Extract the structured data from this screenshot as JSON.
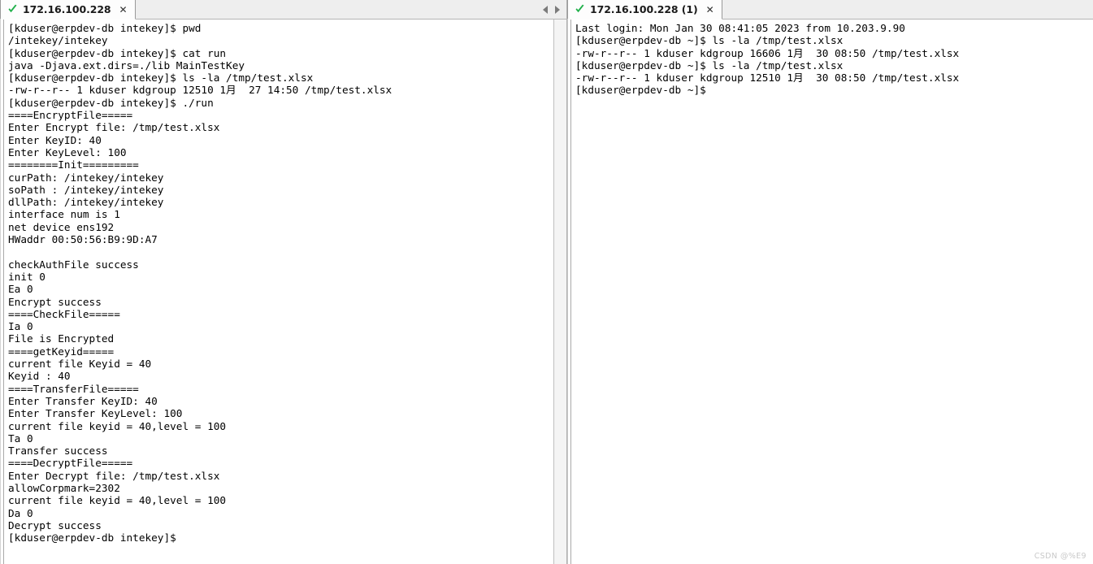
{
  "panels": {
    "left": {
      "tab": {
        "status_icon": "green-check-icon",
        "title": "172.16.100.228",
        "close_label": "✕"
      },
      "nav": {
        "prev_icon": "triangle-left-icon",
        "next_icon": "triangle-right-icon"
      },
      "terminal": {
        "lines": [
          "[kduser@erpdev-db intekey]$ pwd",
          "/intekey/intekey",
          "[kduser@erpdev-db intekey]$ cat run",
          "java -Djava.ext.dirs=./lib MainTestKey",
          "[kduser@erpdev-db intekey]$ ls -la /tmp/test.xlsx",
          "-rw-r--r-- 1 kduser kdgroup 12510 1月  27 14:50 /tmp/test.xlsx",
          "[kduser@erpdev-db intekey]$ ./run",
          "====EncryptFile=====",
          "Enter Encrypt file: /tmp/test.xlsx",
          "Enter KeyID: 40",
          "Enter KeyLevel: 100",
          "========Init=========",
          "curPath: /intekey/intekey",
          "soPath : /intekey/intekey",
          "dllPath: /intekey/intekey",
          "interface num is 1",
          "net device ens192",
          "HWaddr 00:50:56:B9:9D:A7",
          "",
          "checkAuthFile success",
          "init 0",
          "Ea 0",
          "Encrypt success",
          "====CheckFile=====",
          "Ia 0",
          "File is Encrypted",
          "====getKeyid=====",
          "current file Keyid = 40",
          "Keyid : 40",
          "====TransferFile=====",
          "Enter Transfer KeyID: 40",
          "Enter Transfer KeyLevel: 100",
          "current file keyid = 40,level = 100",
          "Ta 0",
          "Transfer success",
          "====DecryptFile=====",
          "Enter Decrypt file: /tmp/test.xlsx",
          "allowCorpmark=2302",
          "current file keyid = 40,level = 100",
          "Da 0",
          "Decrypt success",
          "[kduser@erpdev-db intekey]$"
        ]
      }
    },
    "right": {
      "tab": {
        "status_icon": "green-check-icon",
        "title": "172.16.100.228 (1)",
        "close_label": "✕"
      },
      "terminal": {
        "lines": [
          "Last login: Mon Jan 30 08:41:05 2023 from 10.203.9.90",
          "[kduser@erpdev-db ~]$ ls -la /tmp/test.xlsx",
          "-rw-r--r-- 1 kduser kdgroup 16606 1月  30 08:50 /tmp/test.xlsx",
          "[kduser@erpdev-db ~]$ ls -la /tmp/test.xlsx",
          "-rw-r--r-- 1 kduser kdgroup 12510 1月  30 08:50 /tmp/test.xlsx",
          "[kduser@erpdev-db ~]$"
        ]
      }
    }
  },
  "watermark": {
    "text": "CSDN @%E9"
  },
  "colors": {
    "status_check": "#22b14c",
    "tab_bar_bg": "#eeeeee",
    "tab_active_bg": "#fdfdfd",
    "terminal_bg": "#ffffff",
    "terminal_fg": "#000000"
  }
}
